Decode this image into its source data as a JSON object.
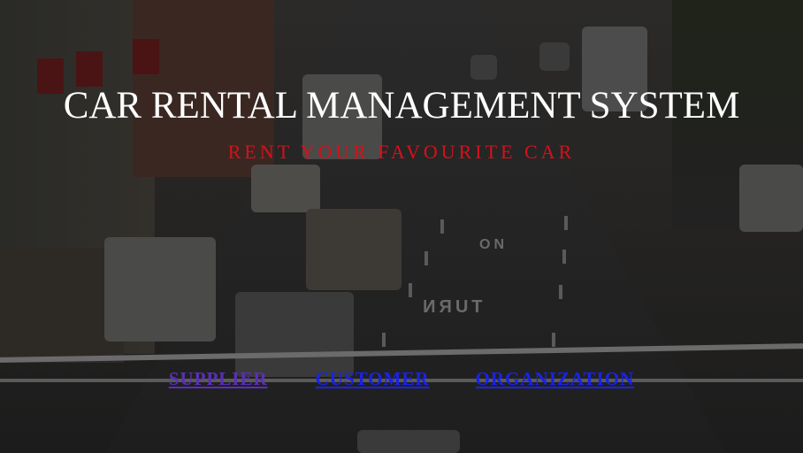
{
  "header": {
    "title": "CAR RENTAL MANAGEMENT SYSTEM",
    "subtitle": "RENT YOUR FAVOURITE CAR"
  },
  "nav": {
    "supplier": "SUPPLIER",
    "customer": "CUSTOMER",
    "organization": "ORGANIZATION"
  },
  "colors": {
    "title": "#ffffff",
    "subtitle": "#d8101a",
    "link_visited": "#5a2fb8",
    "link": "#1a22e8"
  },
  "background": {
    "road_text_1": "ON",
    "road_text_2": "TURN"
  }
}
